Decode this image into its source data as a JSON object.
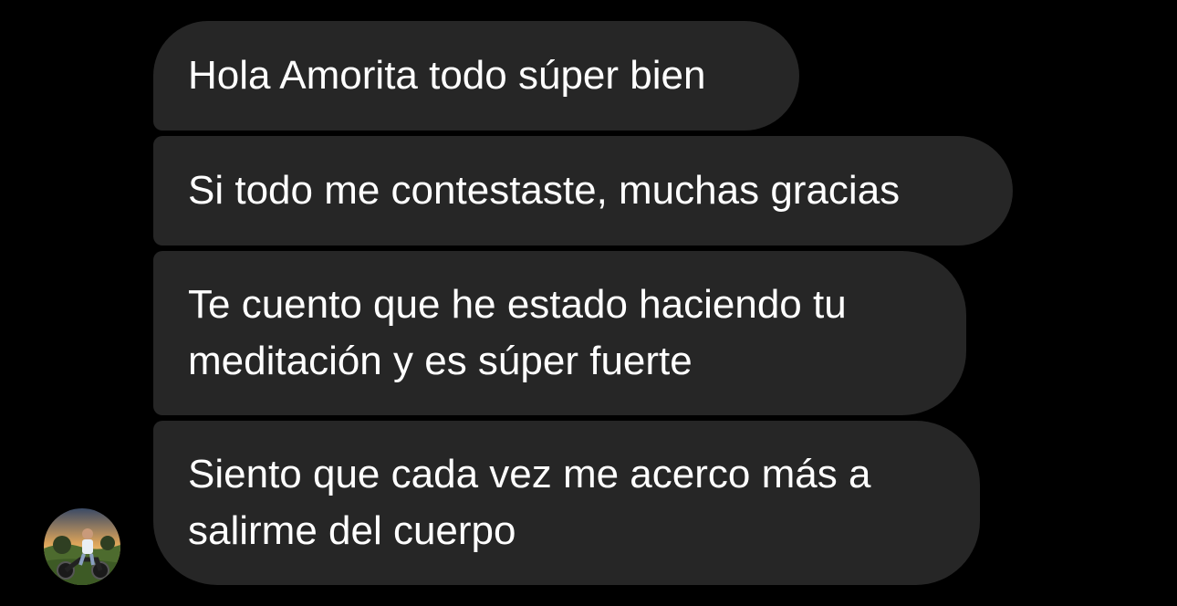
{
  "conversation": {
    "messages": [
      {
        "text": "Hola Amorita todo súper bien"
      },
      {
        "text": "Si todo me contestaste, muchas gracias"
      },
      {
        "text": "Te cuento que he estado haciendo tu\nmeditación y es súper fuerte"
      },
      {
        "text": "Siento que cada vez me acerco más a\nsalirme del cuerpo"
      }
    ],
    "sender_avatar": {
      "icon": "profile-photo-avatar"
    }
  },
  "colors": {
    "background": "#000000",
    "bubble": "#262626",
    "text": "#ffffff"
  }
}
